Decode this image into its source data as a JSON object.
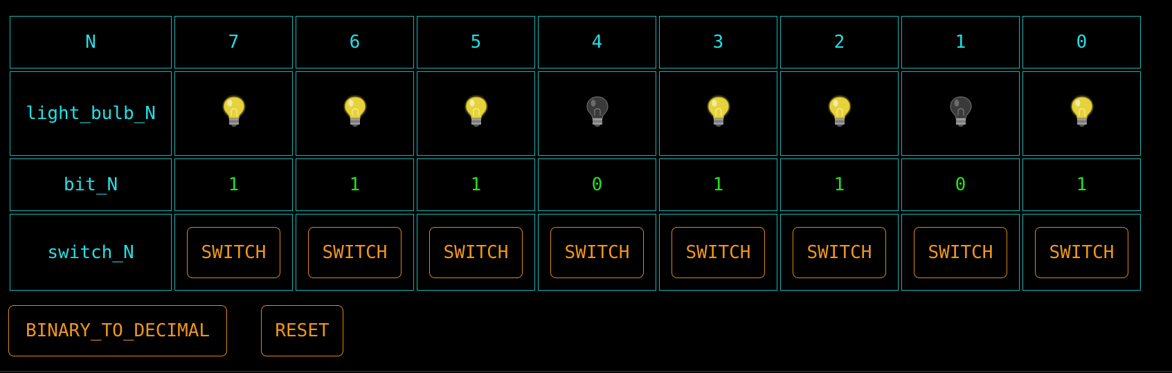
{
  "table": {
    "row_labels": {
      "n": "N",
      "bulb": "light_bulb_N",
      "bit": "bit_N",
      "switch": "switch_N"
    },
    "columns": [
      {
        "n": "7",
        "bit": "1",
        "bulb_on": true,
        "switch_label": "SWITCH"
      },
      {
        "n": "6",
        "bit": "1",
        "bulb_on": true,
        "switch_label": "SWITCH"
      },
      {
        "n": "5",
        "bit": "1",
        "bulb_on": true,
        "switch_label": "SWITCH"
      },
      {
        "n": "4",
        "bit": "0",
        "bulb_on": false,
        "switch_label": "SWITCH"
      },
      {
        "n": "3",
        "bit": "1",
        "bulb_on": true,
        "switch_label": "SWITCH"
      },
      {
        "n": "2",
        "bit": "1",
        "bulb_on": true,
        "switch_label": "SWITCH"
      },
      {
        "n": "1",
        "bit": "0",
        "bulb_on": false,
        "switch_label": "SWITCH"
      },
      {
        "n": "0",
        "bit": "1",
        "bulb_on": true,
        "switch_label": "SWITCH"
      }
    ]
  },
  "buttons": {
    "binary_to_decimal": "BINARY_TO_DECIMAL",
    "reset": "RESET"
  },
  "colors": {
    "background": "#000000",
    "cell_border": "#14b8b8",
    "label_text": "#22e0e6",
    "bit_text": "#1ee61e",
    "button_text": "#f0961a",
    "bulb_on": "#e6d23c",
    "bulb_off": "#3a3a3a"
  },
  "icons": {
    "bulb_on": "light-bulb-on-icon",
    "bulb_off": "light-bulb-off-icon"
  }
}
